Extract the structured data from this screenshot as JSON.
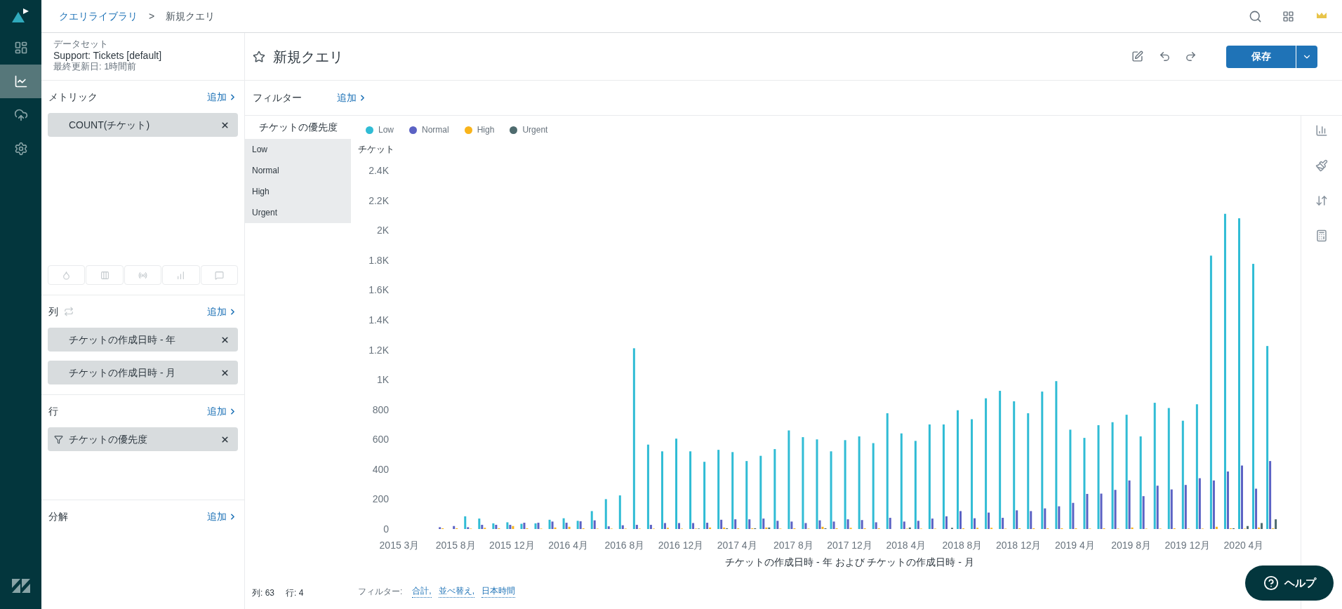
{
  "nav": [
    {
      "kind": "dashboard",
      "selected": false
    },
    {
      "kind": "chart",
      "selected": true
    },
    {
      "kind": "upload",
      "selected": false
    },
    {
      "kind": "settings",
      "selected": false
    }
  ],
  "breadcrumb": {
    "parent": "クエリライブラリ",
    "separator": ">",
    "current": "新規クエリ"
  },
  "dataset": {
    "heading": "データセット",
    "name": "Support: Tickets [default]",
    "updated": "最終更新日: 1時間前"
  },
  "sections": [
    {
      "kind": "metrics",
      "title": "メトリック",
      "add": "追加",
      "chips": [
        {
          "label": "COUNT(チケット)",
          "kind": "plain"
        }
      ]
    },
    {
      "kind": "columns",
      "title": "列",
      "add": "追加",
      "chips": [
        {
          "label": "チケットの作成日時 - 年",
          "kind": "plain"
        },
        {
          "label": "チケットの作成日時 - 月",
          "kind": "plain"
        }
      ]
    },
    {
      "kind": "rows",
      "title": "行",
      "add": "追加",
      "chips": [
        {
          "label": "チケットの優先度",
          "kind": "filter"
        }
      ]
    },
    {
      "kind": "explode",
      "title": "分解",
      "add": "追加"
    }
  ],
  "query": {
    "title": "新規クエリ",
    "starred": false,
    "save_button": "保存"
  },
  "filter_bar": {
    "label": "フィルター",
    "add": "追加"
  },
  "priority_panel": {
    "title": "チケットの優先度",
    "items": [
      "Low",
      "Normal",
      "High",
      "Urgent"
    ]
  },
  "chart_data": {
    "type": "bar",
    "xlabel": "チケットの作成日時 - 年 および チケットの作成日時 - 月",
    "ylabel": "チケット",
    "categories": [
      "2015 3月",
      null,
      null,
      null,
      "2015 8月",
      null,
      null,
      null,
      "2015 12月",
      null,
      null,
      null,
      "2016 4月",
      null,
      null,
      null,
      "2016 8月",
      null,
      null,
      null,
      "2016 12月",
      null,
      null,
      null,
      "2017 4月",
      null,
      null,
      null,
      "2017 8月",
      null,
      null,
      null,
      "2017 12月",
      null,
      null,
      null,
      "2018 4月",
      null,
      null,
      null,
      "2018 8月",
      null,
      null,
      null,
      "2018 12月",
      null,
      null,
      null,
      "2019 4月",
      null,
      null,
      null,
      "2019 8月",
      null,
      null,
      null,
      "2019 12月",
      null,
      null,
      null,
      "2020 4月",
      null,
      null
    ],
    "series": [
      {
        "name": "Low",
        "color": "#30bcd5",
        "values": [
          0,
          0,
          0,
          0,
          0,
          85,
          70,
          38,
          45,
          35,
          38,
          62,
          72,
          55,
          120,
          200,
          225,
          1210,
          565,
          520,
          605,
          520,
          450,
          530,
          515,
          455,
          490,
          535,
          660,
          615,
          600,
          520,
          595,
          620,
          575,
          775,
          640,
          590,
          700,
          700,
          795,
          735,
          875,
          925,
          855,
          775,
          920,
          990,
          665,
          610,
          695,
          715,
          765,
          620,
          845,
          810,
          725,
          835,
          1830,
          2110,
          2080,
          1775,
          1225
        ]
      },
      {
        "name": "Normal",
        "color": "#5b62c4",
        "values": [
          0,
          0,
          0,
          12,
          20,
          12,
          28,
          28,
          28,
          42,
          42,
          50,
          42,
          52,
          58,
          18,
          25,
          28,
          28,
          40,
          40,
          40,
          42,
          62,
          65,
          65,
          70,
          55,
          50,
          40,
          58,
          50,
          65,
          60,
          45,
          75,
          50,
          55,
          70,
          85,
          120,
          72,
          110,
          75,
          125,
          120,
          138,
          152,
          175,
          235,
          237,
          262,
          325,
          220,
          290,
          265,
          295,
          340,
          325,
          385,
          425,
          270,
          455
        ]
      },
      {
        "name": "High",
        "color": "#f9b41b",
        "values": [
          0,
          0,
          0,
          5,
          5,
          3,
          8,
          5,
          20,
          5,
          3,
          10,
          15,
          5,
          3,
          3,
          3,
          3,
          3,
          8,
          3,
          3,
          10,
          10,
          5,
          5,
          10,
          3,
          5,
          3,
          15,
          5,
          8,
          5,
          5,
          0,
          3,
          3,
          3,
          0,
          5,
          8,
          8,
          3,
          5,
          5,
          5,
          5,
          5,
          3,
          5,
          3,
          10,
          3,
          3,
          5,
          3,
          3,
          15,
          5,
          3,
          10,
          5
        ]
      },
      {
        "name": "Urgent",
        "color": "#4e6b6e",
        "values": [
          0,
          0,
          0,
          0,
          0,
          0,
          0,
          0,
          0,
          0,
          0,
          0,
          0,
          0,
          0,
          0,
          0,
          0,
          0,
          0,
          0,
          3,
          0,
          5,
          0,
          5,
          10,
          0,
          0,
          0,
          5,
          0,
          0,
          0,
          0,
          0,
          10,
          0,
          0,
          8,
          0,
          0,
          0,
          0,
          0,
          0,
          0,
          0,
          0,
          0,
          0,
          0,
          0,
          0,
          0,
          0,
          0,
          0,
          0,
          5,
          20,
          40,
          65
        ]
      }
    ],
    "ylim": [
      0,
      2400
    ],
    "yticks": [
      0,
      200,
      400,
      600,
      800,
      {
        "value": 1000,
        "label": "1K"
      },
      {
        "value": 1200,
        "label": "1.2K"
      },
      {
        "value": 1400,
        "label": "1.4K"
      },
      {
        "value": 1600,
        "label": "1.6K"
      },
      {
        "value": 1800,
        "label": "1.8K"
      },
      {
        "value": 2000,
        "label": "2K"
      },
      {
        "value": 2200,
        "label": "2.2K"
      },
      {
        "value": 2400,
        "label": "2.4K"
      }
    ]
  },
  "footer": {
    "label": "フィルター:",
    "links": [
      "合計,",
      "並べ替え,",
      "日本時間"
    ]
  },
  "status": [
    "列: 63",
    "行: 4"
  ],
  "help_button": "ヘルプ"
}
